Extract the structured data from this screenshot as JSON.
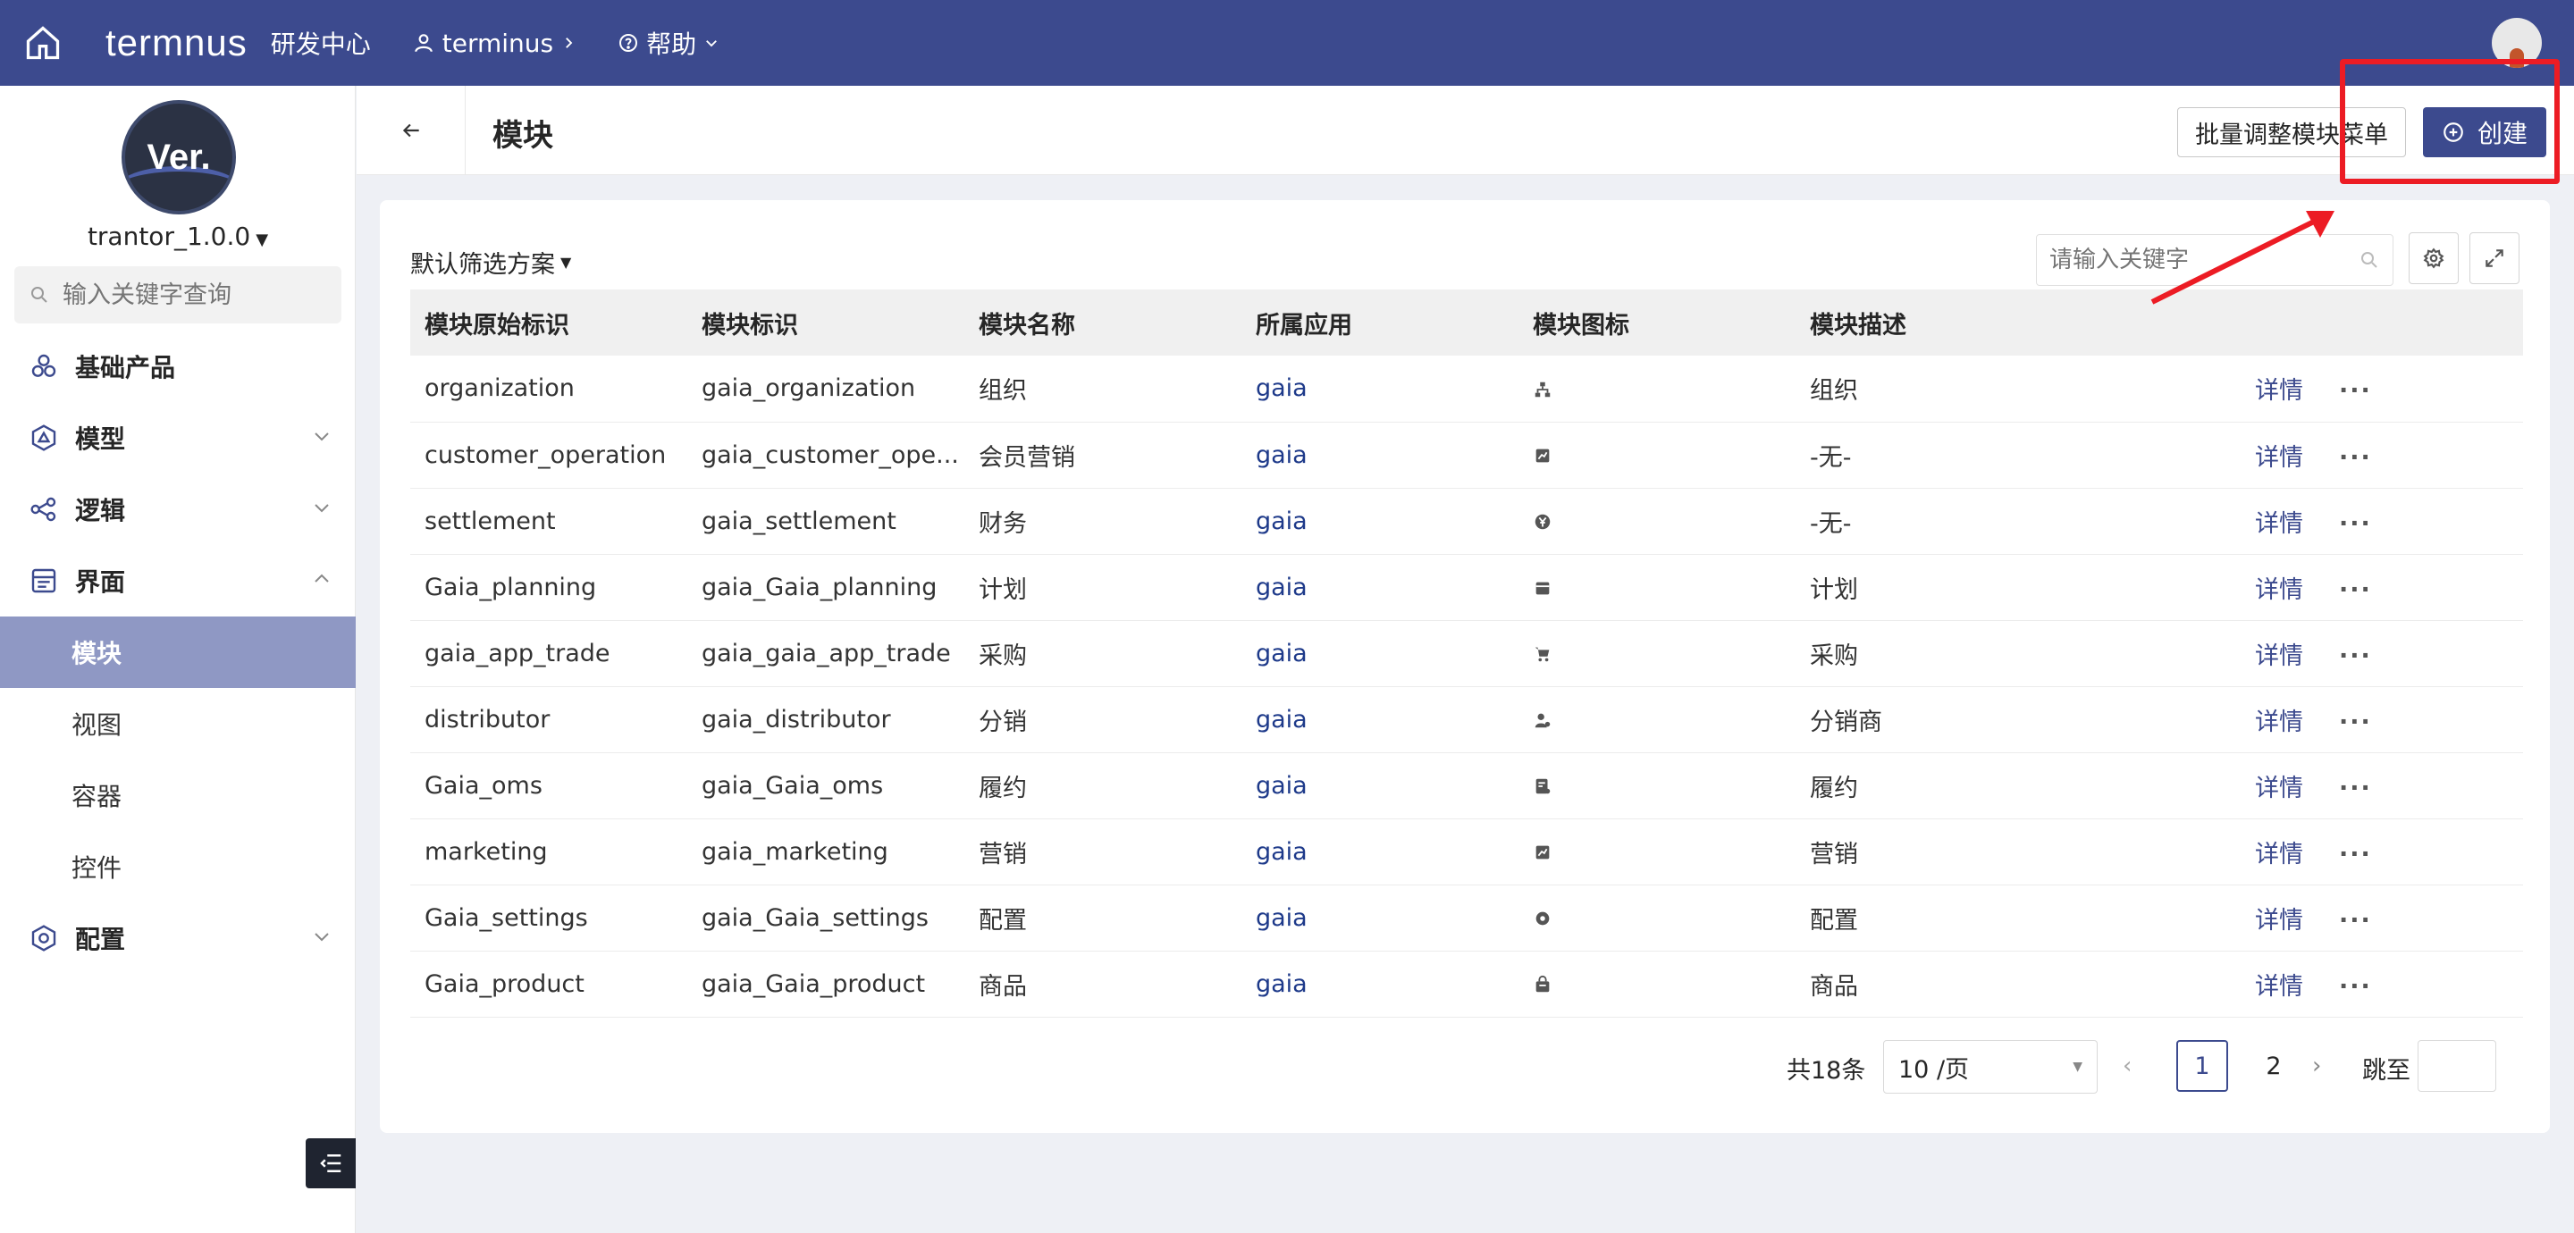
{
  "topbar": {
    "logo": "termnus",
    "center_name": "研发中心",
    "tenant": "terminus",
    "help": "帮助"
  },
  "sidebar": {
    "version_logo": "Ver.",
    "version": "trantor_1.0.0",
    "search_placeholder": "输入关键字查询",
    "items": [
      {
        "label": "基础产品"
      },
      {
        "label": "模型"
      },
      {
        "label": "逻辑"
      },
      {
        "label": "界面"
      },
      {
        "label": "配置"
      }
    ],
    "sub_items": [
      {
        "label": "模块"
      },
      {
        "label": "视图"
      },
      {
        "label": "容器"
      },
      {
        "label": "控件"
      }
    ]
  },
  "header": {
    "title": "模块",
    "batch_button": "批量调整模块菜单",
    "create_button": "创建"
  },
  "list": {
    "filter_scheme": "默认筛选方案",
    "keyword_placeholder": "请输入关键字",
    "columns": [
      "模块原始标识",
      "模块标识",
      "模块名称",
      "所属应用",
      "模块图标",
      "模块描述"
    ],
    "detail_label": "详情",
    "more_label": "···",
    "rows": [
      {
        "orig": "organization",
        "key": "gaia_organization",
        "name": "组织",
        "app": "gaia",
        "icon": "sitemap-icon",
        "desc": "组织"
      },
      {
        "orig": "customer_operation",
        "key": "gaia_customer_ope...",
        "name": "会员营销",
        "app": "gaia",
        "icon": "chart-icon",
        "desc": "-无-"
      },
      {
        "orig": "settlement",
        "key": "gaia_settlement",
        "name": "财务",
        "app": "gaia",
        "icon": "yen-icon",
        "desc": "-无-"
      },
      {
        "orig": "Gaia_planning",
        "key": "gaia_Gaia_planning",
        "name": "计划",
        "app": "gaia",
        "icon": "calendar-icon",
        "desc": "计划"
      },
      {
        "orig": "gaia_app_trade",
        "key": "gaia_gaia_app_trade",
        "name": "采购",
        "app": "gaia",
        "icon": "cart-icon",
        "desc": "采购"
      },
      {
        "orig": "distributor",
        "key": "gaia_distributor",
        "name": "分销",
        "app": "gaia",
        "icon": "user-icon",
        "desc": "分销商"
      },
      {
        "orig": "Gaia_oms",
        "key": "gaia_Gaia_oms",
        "name": "履约",
        "app": "gaia",
        "icon": "order-icon",
        "desc": "履约"
      },
      {
        "orig": "marketing",
        "key": "gaia_marketing",
        "name": "营销",
        "app": "gaia",
        "icon": "chart-icon",
        "desc": "营销"
      },
      {
        "orig": "Gaia_settings",
        "key": "gaia_Gaia_settings",
        "name": "配置",
        "app": "gaia",
        "icon": "gear-icon",
        "desc": "配置"
      },
      {
        "orig": "Gaia_product",
        "key": "gaia_Gaia_product",
        "name": "商品",
        "app": "gaia",
        "icon": "bag-icon",
        "desc": "商品"
      }
    ]
  },
  "pager": {
    "total": "共18条",
    "page_size": "10 /页",
    "pages": [
      "1",
      "2"
    ],
    "goto": "跳至"
  },
  "colors": {
    "primary": "#3c4a8e",
    "annotation": "#ec1c24",
    "active_menu": "#8f98c4"
  }
}
